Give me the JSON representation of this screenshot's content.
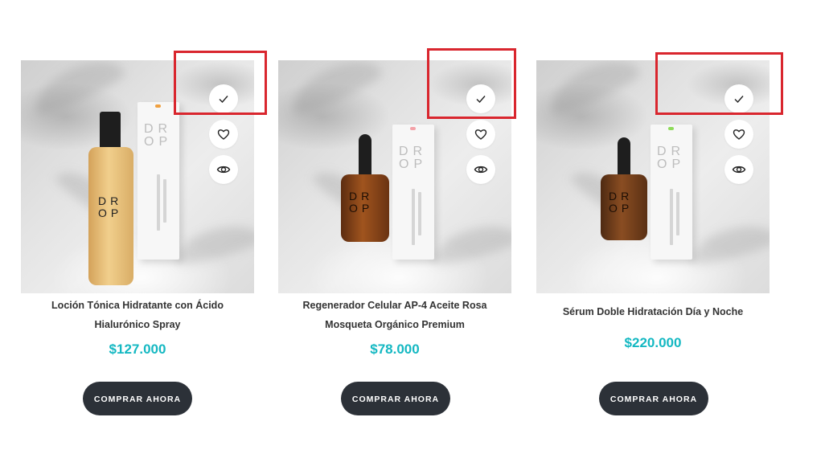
{
  "colors": {
    "price": "#14b8c2",
    "button_bg": "#2c3138",
    "button_text": "#ffffff",
    "highlight": "#d9262e"
  },
  "icons": {
    "compare": "checkmark-icon",
    "wishlist": "heart-icon",
    "quick_view": "eye-icon"
  },
  "products": [
    {
      "name_line1": "Loción Tónica Hidratante con Ácido",
      "name_line2": "Hialurónico Spray",
      "price": "$127.000",
      "button": "COMPRAR AHORA",
      "packaging": {
        "logo": "DR OP",
        "bottle": "DR OP"
      }
    },
    {
      "name_line1": "Regenerador Celular AP-4 Aceite Rosa",
      "name_line2": "Mosqueta Orgánico Premium",
      "price": "$78.000",
      "button": "COMPRAR AHORA",
      "packaging": {
        "logo": "DR OP",
        "bottle": "DR OP"
      }
    },
    {
      "name_line1": "Sérum Doble Hidratación Día y Noche",
      "price": "$220.000",
      "button": "COMPRAR AHORA",
      "packaging": {
        "logo": "DR OP",
        "bottle": "DR OP"
      }
    }
  ]
}
